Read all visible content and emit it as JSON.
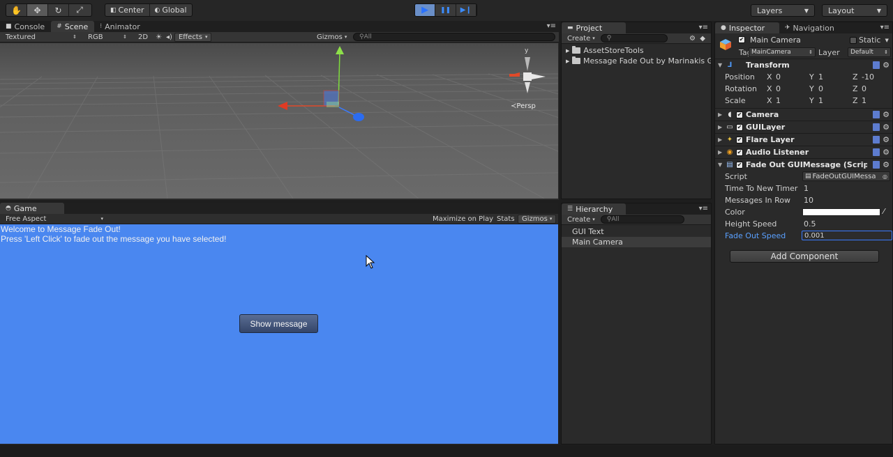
{
  "toolbar": {
    "tools": [
      {
        "icon": "hand-icon",
        "glyph": "✋"
      },
      {
        "icon": "move-icon",
        "glyph": "✥"
      },
      {
        "icon": "rotate-icon",
        "glyph": "↻"
      },
      {
        "icon": "scale-icon",
        "glyph": "⤢"
      }
    ],
    "pivot_label": "Center",
    "space_label": "Global",
    "play_glyph": "▶",
    "pause_glyph": "❚❚",
    "step_glyph": "▶❙",
    "layers_label": "Layers",
    "layout_label": "Layout"
  },
  "scene_panel": {
    "tabs": [
      "Console",
      "Scene",
      "Animator"
    ],
    "shading_mode": "Textured",
    "render_mode": "RGB",
    "toggle_2d": "2D",
    "effects_label": "Effects",
    "gizmos_label": "Gizmos",
    "search_placeholder": "All",
    "persp_label": "Persp",
    "axis_y": "y"
  },
  "game_panel": {
    "tab": "Game",
    "aspect": "Free Aspect",
    "maximize_label": "Maximize on Play",
    "stats_label": "Stats",
    "gizmos_label": "Gizmos",
    "welcome_text": "Welcome to Message Fade Out!",
    "instruction_text": "Press 'Left Click' to fade out the message you have selected!",
    "show_button": "Show message"
  },
  "project_panel": {
    "tab": "Project",
    "create_label": "Create",
    "items": [
      "AssetStoreTools",
      "Message Fade Out by Marinakis Gi"
    ]
  },
  "hierarchy_panel": {
    "tab": "Hierarchy",
    "create_label": "Create",
    "search_placeholder": "All",
    "items": [
      {
        "label": "GUI Text",
        "selected": false
      },
      {
        "label": "Main Camera",
        "selected": true
      }
    ]
  },
  "inspector": {
    "tabs": [
      "Inspector",
      "Navigation"
    ],
    "object_name": "Main Camera",
    "static_label": "Static",
    "tag_label": "Tag",
    "tag_value": "MainCamera",
    "layer_label": "Layer",
    "layer_value": "Default",
    "transform": {
      "title": "Transform",
      "rows": [
        {
          "label": "Position",
          "x": "0",
          "y": "1",
          "z": "-10"
        },
        {
          "label": "Rotation",
          "x": "0",
          "y": "0",
          "z": "0"
        },
        {
          "label": "Scale",
          "x": "1",
          "y": "1",
          "z": "1"
        }
      ]
    },
    "components": [
      "Camera",
      "GUILayer",
      "Flare Layer",
      "Audio Listener"
    ],
    "script_component": {
      "title": "Fade Out GUIMessage (Script)",
      "script_label": "Script",
      "script_value": "FadeOutGUIMessa",
      "fields": [
        {
          "label": "Time To New Timer",
          "value": "1"
        },
        {
          "label": "Messages In Row",
          "value": "10"
        },
        {
          "label": "Color",
          "value": ""
        },
        {
          "label": "Height Speed",
          "value": "0.5"
        },
        {
          "label": "Fade Out Speed",
          "value": "0.001"
        }
      ]
    },
    "add_component": "Add Component"
  },
  "colors": {
    "accent": "#3b8cff",
    "game_bg": "#4a87f0",
    "selected_field_label": "#5aa0ff"
  }
}
